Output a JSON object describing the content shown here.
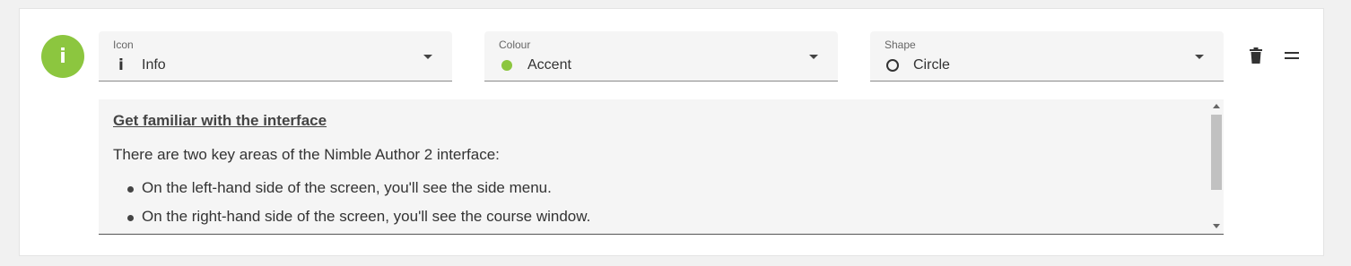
{
  "badge": {
    "glyph": "i",
    "icon": "info-icon",
    "color": "#8cc63f"
  },
  "fields": {
    "icon": {
      "label": "Icon",
      "value": "Info",
      "icon": "info-icon"
    },
    "colour": {
      "label": "Colour",
      "value": "Accent",
      "swatch_color": "#8cc63f"
    },
    "shape": {
      "label": "Shape",
      "value": "Circle",
      "icon": "circle-outline-icon"
    }
  },
  "actions": {
    "delete_icon": "trash-icon",
    "drag_icon": "drag-handle-icon"
  },
  "editor": {
    "heading": "Get familiar with the interface",
    "paragraph": "There are two key areas of the Nimble Author 2 interface:",
    "bullets": [
      "On the left-hand side of the screen, you'll see the side menu.",
      "On the right-hand side of the screen, you'll see the course window."
    ]
  }
}
